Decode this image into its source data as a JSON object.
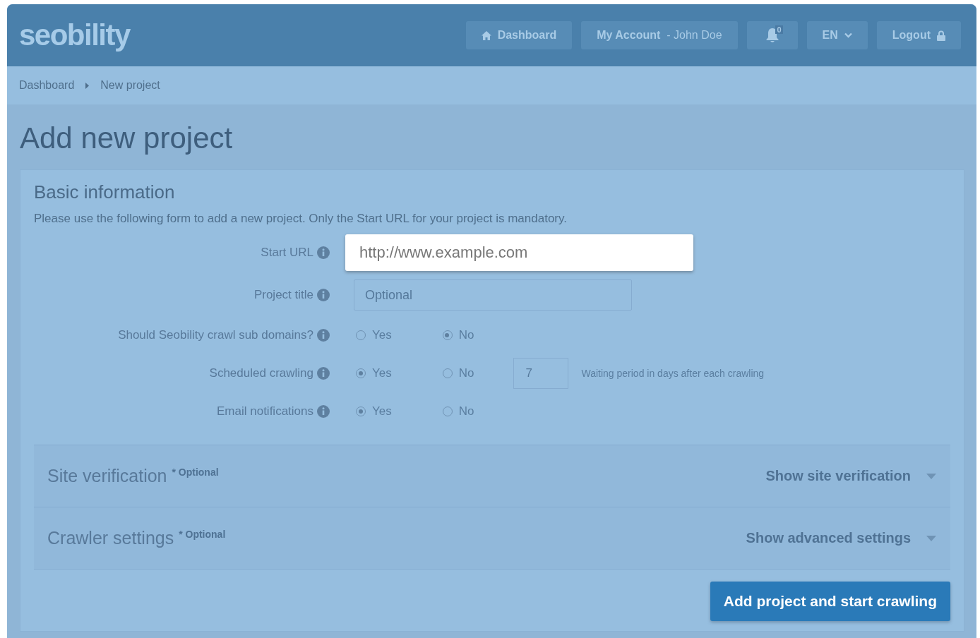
{
  "header": {
    "logo": "seobility",
    "nav": [
      {
        "kind": "home",
        "label": "Dashboard"
      },
      {
        "kind": "account",
        "label": "My Account",
        "user": "- John Doe"
      },
      {
        "kind": "notifications",
        "count": "0"
      },
      {
        "kind": "language",
        "label": "EN"
      },
      {
        "kind": "logout",
        "label": "Logout"
      }
    ]
  },
  "breadcrumb": [
    "Dashboard",
    "New project"
  ],
  "page_title": "Add new project",
  "basic_information": {
    "title": "Basic information",
    "intro": "Please use the following form to add a new project. Only the Start URL for your project is mandatory.",
    "fields": [
      {
        "kind": "text",
        "label": "Start URL",
        "placeholder": "http://www.example.com",
        "highlighted": true
      },
      {
        "kind": "text",
        "label": "Project title",
        "placeholder": "Optional",
        "highlighted": false
      },
      {
        "kind": "radio",
        "label": "Should Seobility crawl sub domains?",
        "options": [
          {
            "label": "Yes",
            "selected": false
          },
          {
            "label": "No",
            "selected": true
          }
        ]
      },
      {
        "kind": "radio",
        "label": "Scheduled crawling",
        "options": [
          {
            "label": "Yes",
            "selected": true
          },
          {
            "label": "No",
            "selected": false
          }
        ],
        "days": "7",
        "hint": "Waiting period in days after each crawling"
      },
      {
        "kind": "radio",
        "label": "Email notifications",
        "options": [
          {
            "label": "Yes",
            "selected": true
          },
          {
            "label": "No",
            "selected": false
          }
        ]
      }
    ]
  },
  "sections": [
    {
      "title": "Site verification",
      "note": "* Optional",
      "toggle": "Show site verification"
    },
    {
      "title": "Crawler settings",
      "note": "* Optional",
      "toggle": "Show advanced settings"
    }
  ],
  "submit": "Add project and start crawling"
}
